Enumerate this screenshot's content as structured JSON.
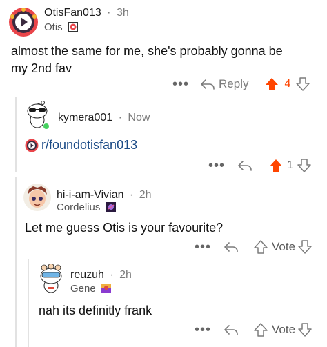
{
  "colors": {
    "upvote": "#ff4500",
    "muted": "#7c7c7c",
    "link": "#1a4a86"
  },
  "comments": [
    {
      "username": "OtisFan013",
      "time": "3h",
      "flair": "Otis",
      "body_lines": [
        "almost the same for me, she's probably gonna be",
        "my 2nd fav"
      ],
      "reply_label": "Reply",
      "score": "4",
      "upvoted": true
    },
    {
      "username": "kymera001",
      "time": "Now",
      "link_text": "r/foundotisfan013",
      "score": "1",
      "upvoted": true
    },
    {
      "username": "hi-i-am-Vivian",
      "time": "2h",
      "flair": "Cordelius",
      "body": "Let me guess Otis is your favourite?",
      "vote_label": "Vote"
    },
    {
      "username": "reuzuh",
      "time": "2h",
      "flair": "Gene",
      "body": "nah its definitly frank",
      "vote_label": "Vote"
    }
  ],
  "separator": "·",
  "more_label": "•••",
  "icons": [
    "more-icon",
    "reply-arrow-icon",
    "upvote-icon",
    "downvote-icon"
  ]
}
